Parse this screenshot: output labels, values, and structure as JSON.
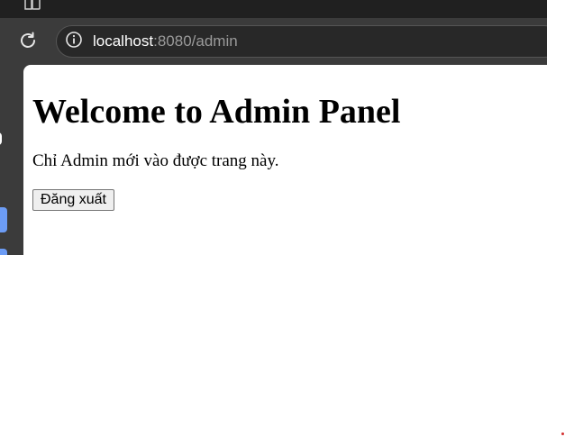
{
  "browser": {
    "tab_icon": "tab-actions-icon",
    "reload_icon": "reload-icon",
    "site_info_icon": "info-icon",
    "url_host": "localhost",
    "url_path": ":8080/admin"
  },
  "page": {
    "heading": "Welcome to Admin Panel",
    "description": "Chỉ Admin mới vào được trang này.",
    "logout_label": "Đăng xuất"
  },
  "colors": {
    "chrome_bg": "#3b3b3b",
    "tabstrip_bg": "#202020",
    "omnibox_bg": "#282828",
    "sidebar_accent": "#6c9cf5",
    "marker": "#d32f2f"
  }
}
